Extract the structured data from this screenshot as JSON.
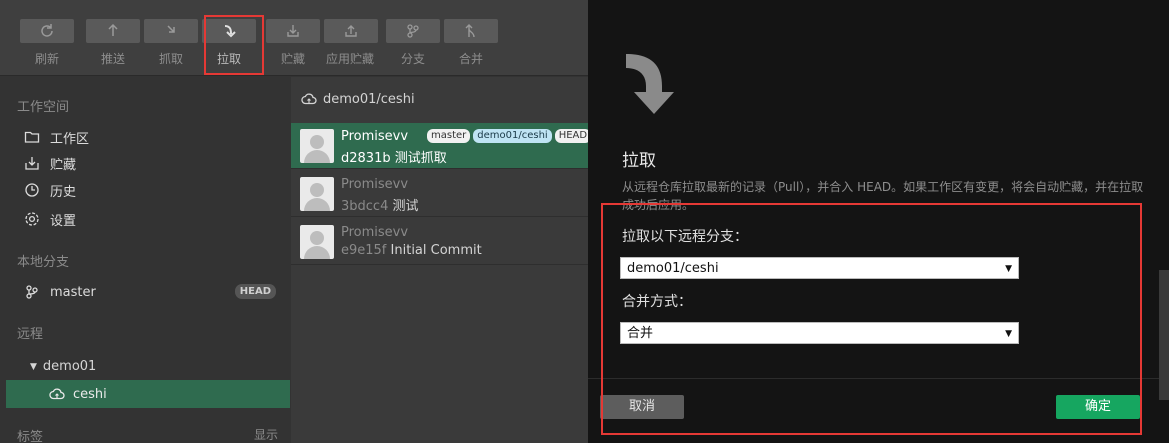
{
  "toolbar": {
    "buttons": [
      {
        "label": "刷新",
        "icon": "refresh-icon"
      },
      {
        "label": "推送",
        "icon": "push-icon"
      },
      {
        "label": "抓取",
        "icon": "fetch-icon"
      },
      {
        "label": "拉取",
        "icon": "pull-icon"
      },
      {
        "label": "贮藏",
        "icon": "stash-icon"
      },
      {
        "label": "应用贮藏",
        "icon": "apply-stash-icon"
      },
      {
        "label": "分支",
        "icon": "branch-icon"
      },
      {
        "label": "合并",
        "icon": "merge-icon"
      }
    ]
  },
  "sidebar": {
    "workspace_title": "工作空间",
    "items": [
      {
        "label": "工作区",
        "icon": "folder-icon"
      },
      {
        "label": "贮藏",
        "icon": "stash-icon"
      },
      {
        "label": "历史",
        "icon": "history-icon"
      },
      {
        "label": "设置",
        "icon": "gear-icon"
      }
    ],
    "local_branches_title": "本地分支",
    "local_branch": {
      "name": "master",
      "badge": "HEAD"
    },
    "remote_title": "远程",
    "remote_group": "demo01",
    "remote_branch": "ceshi",
    "tags_title": "标签",
    "tags_show": "显示"
  },
  "commit_list": {
    "repo": "demo01/ceshi",
    "commits": [
      {
        "author": "Promisevv",
        "hash": "d2831b",
        "message": "测试抓取",
        "tags": [
          "master",
          "demo01/ceshi",
          "HEAD"
        ],
        "selected": true
      },
      {
        "author": "Promisevv",
        "hash": "3bdcc4",
        "message": "测试",
        "tags": [],
        "selected": false
      },
      {
        "author": "Promisevv",
        "hash": "e9e15f",
        "message": "Initial Commit",
        "tags": [],
        "selected": false
      }
    ]
  },
  "dialog": {
    "title": "拉取",
    "description": "从远程仓库拉取最新的记录（Pull），并合入 HEAD。如果工作区有变更，将会自动贮藏，并在拉取成功后应用。",
    "remote_branch_label": "拉取以下远程分支：",
    "remote_branch_value": "demo01/ceshi",
    "merge_mode_label": "合并方式：",
    "merge_mode_value": "合并",
    "cancel_label": "取消",
    "ok_label": "确定"
  },
  "colors": {
    "accent_green": "#16a660",
    "selection_green": "#2f6b4f",
    "highlight_red": "#e53935"
  }
}
